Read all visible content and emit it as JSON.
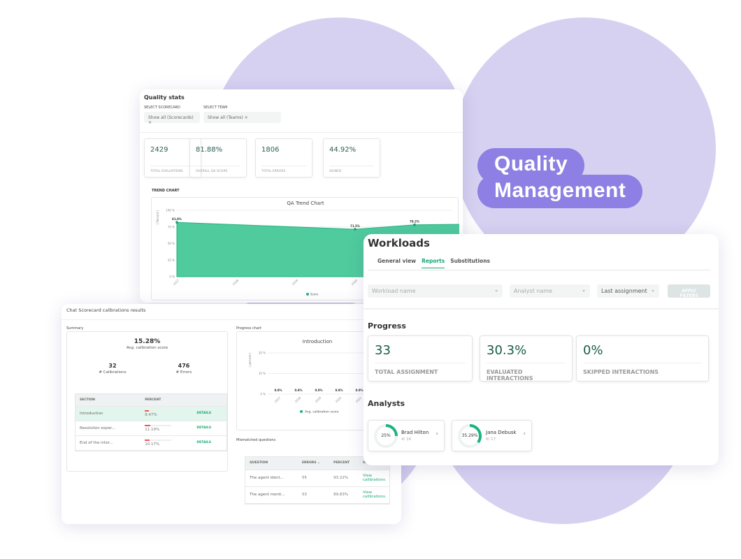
{
  "badge": {
    "line1": "Quality",
    "line2": "Management"
  },
  "colors": {
    "accent": "#1db37e",
    "badge": "#8d7fe3",
    "background_blob": "#d6d1f1"
  },
  "quality_stats": {
    "title": "Quality stats",
    "scorecard_label": "SELECT SCORECARD",
    "scorecard_value": "Show all (Scorecards)",
    "team_label": "SELECT TEAM",
    "team_value": "Show all (Teams)",
    "stats": [
      {
        "value": "2429",
        "label": "TOTAL EVALUATIONS"
      },
      {
        "value": "81.88%",
        "label": "OVERALL QA SCORE"
      },
      {
        "value": "1806",
        "label": "TOTAL ERRORS"
      },
      {
        "value": "44.92%",
        "label": "SIGNED"
      }
    ],
    "trend_label": "TREND CHART"
  },
  "chart_data": [
    {
      "type": "area",
      "title": "QA Trend Chart",
      "ylabel": "( Percent )",
      "ylim": [
        0,
        100
      ],
      "yticks": [
        "0 %",
        "25 %",
        "50 %",
        "75 %",
        "100 %"
      ],
      "x": [
        "2017",
        "2018",
        "2019",
        "2020",
        "2021",
        "2022"
      ],
      "xtick_labels": [
        "2017",
        "2018",
        "2019",
        "2020"
      ],
      "series": [
        {
          "name": "Score",
          "points": [
            {
              "x": "2017",
              "y": 81.9,
              "label": "81.9%"
            },
            {
              "x": "2020",
              "y": 71.5,
              "label": "71.5%"
            },
            {
              "x": "2021",
              "y": 78.2,
              "label": "78.2%"
            },
            {
              "x": "2022",
              "y": 79.1,
              "label": "79.1%"
            }
          ]
        }
      ],
      "legend": "bottom",
      "grid": true
    },
    {
      "type": "bar",
      "title": "Introduction",
      "ylabel": "( percent )",
      "ylim": [
        0,
        20
      ],
      "yticks": [
        "0 %",
        "10 %",
        "20 %"
      ],
      "categories": [
        "2017",
        "2018",
        "2019",
        "2020",
        "2021"
      ],
      "series": [
        {
          "name": "Avg. calibration score",
          "values": [
            0,
            0,
            0,
            0,
            0
          ],
          "labels": [
            "0.0%",
            "0.0%",
            "0.0%",
            "0.0%",
            "0.0%"
          ]
        }
      ],
      "legend": "bottom",
      "grid": true
    }
  ],
  "calibrations": {
    "title": "Chat Scorecard calibrations results",
    "summary_label": "Summary",
    "avg_score": "15.28%",
    "avg_score_label": "Avg. calibration score",
    "calibrations": "32",
    "calibrations_label": "# Calibrations",
    "errors": "476",
    "errors_label": "# Errors",
    "section_headers": [
      "SECTION",
      "PERCENT"
    ],
    "sections": [
      {
        "name": "Introduction",
        "percent": "8.47%",
        "value": 8.47,
        "action": "DETAILS"
      },
      {
        "name": "Resolution exper...",
        "percent": "11.19%",
        "value": 11.19,
        "action": "DETAILS"
      },
      {
        "name": "End of the inter...",
        "percent": "10.17%",
        "value": 10.17,
        "action": "DETAILS"
      }
    ],
    "progress_label": "Progress chart",
    "mismatched_label": "Mismatched questions",
    "question_headers": [
      "QUESTION",
      "ERRORS",
      "PERCENT",
      "OPTIONS"
    ],
    "questions": [
      {
        "q": "The agent ident...",
        "errors": "55",
        "percent": "93.22%",
        "action": "View calibrations"
      },
      {
        "q": "The agent menti...",
        "errors": "53",
        "percent": "89.83%",
        "action": "View calibrations"
      }
    ]
  },
  "workloads": {
    "title": "Workloads",
    "tabs": [
      "General view",
      "Reports",
      "Substitutions"
    ],
    "active_tab": "Reports",
    "workload_placeholder": "Workload name",
    "analyst_placeholder": "Analyst name",
    "period_value": "Last assignment",
    "apply": "APPLY FILTERS",
    "progress_title": "Progress",
    "progress": [
      {
        "value": "33",
        "label": "TOTAL ASSIGNMENT"
      },
      {
        "value": "30.3%",
        "label": "EVALUATED INTERACTIONS"
      },
      {
        "value": "0%",
        "label": "SKIPPED INTERACTIONS"
      }
    ],
    "analysts_title": "Analysts",
    "analysts": [
      {
        "name": "Brad Hilton",
        "percent": "25%",
        "value": 25,
        "count": "4/ 16"
      },
      {
        "name": "Jana Debusk",
        "percent": "35.29%",
        "value": 35.29,
        "count": "6/ 17"
      }
    ]
  }
}
